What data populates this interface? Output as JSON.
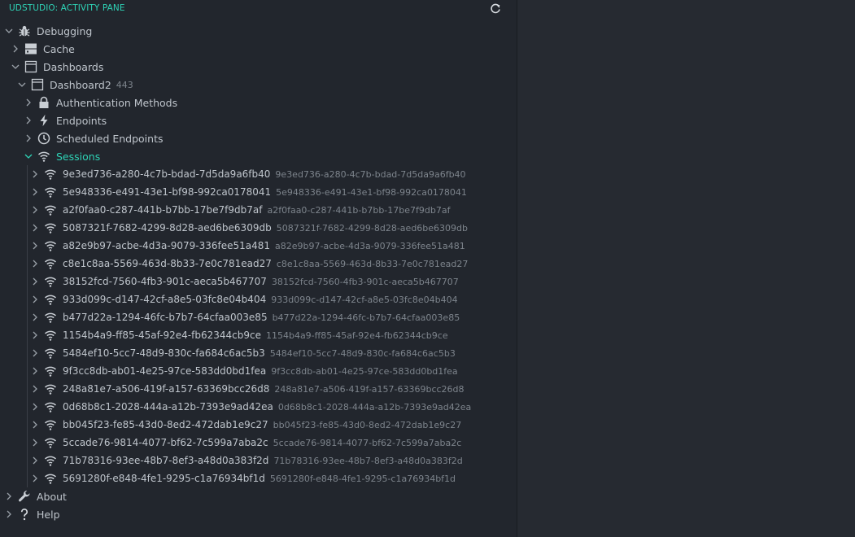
{
  "pane": {
    "title": "UDSTUDIO: ACTIVITY PANE",
    "refresh_icon": "refresh-icon",
    "accent_color": "#2ed3b6"
  },
  "tree": {
    "debugging": {
      "label": "Debugging",
      "icon": "bug-icon"
    },
    "cache": {
      "label": "Cache",
      "icon": "server-icon"
    },
    "dashboards": {
      "label": "Dashboards",
      "icon": "window-icon"
    },
    "dashboard2": {
      "label": "Dashboard2",
      "desc": "443",
      "icon": "window-icon"
    },
    "auth": {
      "label": "Authentication Methods",
      "icon": "lock-icon"
    },
    "endpoints": {
      "label": "Endpoints",
      "icon": "bolt-icon"
    },
    "scheduled": {
      "label": "Scheduled Endpoints",
      "icon": "clock-icon"
    },
    "sessions": {
      "label": "Sessions",
      "icon": "wifi-icon"
    },
    "session_items": [
      {
        "id": "9e3ed736-a280-4c7b-bdad-7d5da9a6fb40"
      },
      {
        "id": "5e948336-e491-43e1-bf98-992ca0178041"
      },
      {
        "id": "a2f0faa0-c287-441b-b7bb-17be7f9db7af"
      },
      {
        "id": "5087321f-7682-4299-8d28-aed6be6309db"
      },
      {
        "id": "a82e9b97-acbe-4d3a-9079-336fee51a481"
      },
      {
        "id": "c8e1c8aa-5569-463d-8b33-7e0c781ead27"
      },
      {
        "id": "38152fcd-7560-4fb3-901c-aeca5b467707"
      },
      {
        "id": "933d099c-d147-42cf-a8e5-03fc8e04b404"
      },
      {
        "id": "b477d22a-1294-46fc-b7b7-64cfaa003e85"
      },
      {
        "id": "1154b4a9-ff85-45af-92e4-fb62344cb9ce"
      },
      {
        "id": "5484ef10-5cc7-48d9-830c-fa684c6ac5b3"
      },
      {
        "id": "9f3cc8db-ab01-4e25-97ce-583dd0bd1fea"
      },
      {
        "id": "248a81e7-a506-419f-a157-63369bcc26d8"
      },
      {
        "id": "0d68b8c1-2028-444a-a12b-7393e9ad42ea"
      },
      {
        "id": "bb045f23-fe85-43d0-8ed2-472dab1e9c27"
      },
      {
        "id": "5ccade76-9814-4077-bf62-7c599a7aba2c"
      },
      {
        "id": "71b78316-93ee-48b7-8ef3-a48d0a383f2d"
      },
      {
        "id": "5691280f-e848-4fe1-9295-c1a76934bf1d"
      }
    ],
    "about": {
      "label": "About",
      "icon": "wrench-icon"
    },
    "help": {
      "label": "Help",
      "icon": "question-icon"
    }
  }
}
